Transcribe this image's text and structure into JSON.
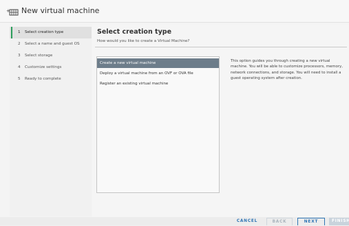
{
  "window": {
    "title": "New virtual machine",
    "icon": "new-vm-icon"
  },
  "steps": [
    {
      "num": "1",
      "label": "Select creation type",
      "active": true
    },
    {
      "num": "2",
      "label": "Select a name and guest OS",
      "active": false
    },
    {
      "num": "3",
      "label": "Select storage",
      "active": false
    },
    {
      "num": "4",
      "label": "Customize settings",
      "active": false
    },
    {
      "num": "5",
      "label": "Ready to complete",
      "active": false
    }
  ],
  "main": {
    "title": "Select creation type",
    "subtitle": "How would you like to create a Virtual Machine?",
    "options": [
      {
        "label": "Create a new virtual machine",
        "selected": true
      },
      {
        "label": "Deploy a virtual machine from an OVF or OVA file",
        "selected": false
      },
      {
        "label": "Register an existing virtual machine",
        "selected": false
      }
    ],
    "description": "This option guides you through creating a new virtual machine. You will be able to customize processors, memory, network connections, and storage. You will need to install a guest operating system after creation."
  },
  "footer": {
    "cancel": "CANCEL",
    "back": "BACK",
    "next": "NEXT",
    "finish": "FINISH"
  },
  "colors": {
    "active_step_marker": "#2a9c5a",
    "selected_option_bg": "#6d7d8a",
    "primary_button": "#2f75b5"
  }
}
